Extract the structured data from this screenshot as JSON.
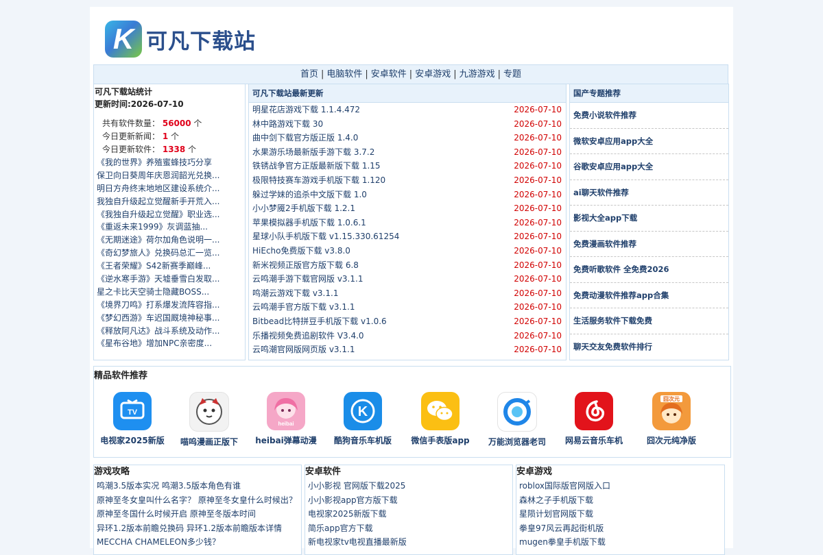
{
  "header": {
    "logo_letter": "K",
    "site_name": "可凡下载站"
  },
  "nav": {
    "items": [
      "首页",
      "电脑软件",
      "安卓软件",
      "安卓游戏",
      "九游游戏",
      "专题"
    ],
    "separator": "|"
  },
  "stats": {
    "title": "可凡下载站统计",
    "updated": "更新时间:2026-07-10",
    "software_label": "共有软件数量：",
    "software_count": "56000",
    "news_label": "今日更新新闻：",
    "news_count": "1",
    "today_soft_label": "今日更新软件：",
    "today_soft_count": "1338",
    "unit": "个",
    "news": [
      "《我的世界》养殖蜜蜂技巧分享",
      "保卫向日葵周年庆恩润韶光兑换...",
      "明日方舟终末地地区建设系统介...",
      "我独自升级起立觉醒新手开荒入...",
      "《我独自升级起立觉醒》职业选...",
      "《重返未来1999》灰调蓝抽...",
      "《无期迷途》荷尔加角色说明一...",
      "《奇幻梦旅人》兑换码总汇一览...",
      "《王者荣耀》S42新赛季巅峰...",
      "《逆水寒手游》天墟垂雪白发取...",
      "星之卡比天空骑士隐藏BOSS...",
      "《境界刀鸣》打系爆发流阵容指...",
      "《梦幻西游》车迟国厩境神秘事...",
      "《释放阿凡达》战斗系统及动作...",
      "《星布谷地》增加NPC亲密度..."
    ]
  },
  "updates": {
    "title": "可凡下载站最新更新",
    "rows": [
      {
        "name": "明星花店游戏下载 1.1.4.472",
        "date": "2026-07-10"
      },
      {
        "name": "林中路游戏下载 30",
        "date": "2026-07-10"
      },
      {
        "name": "曲中剑下载官方版正版 1.4.0",
        "date": "2026-07-10"
      },
      {
        "name": "水果游乐场最新版手游下载 3.7.2",
        "date": "2026-07-10"
      },
      {
        "name": "铁锈战争官方正版最新版下载 1.15",
        "date": "2026-07-10"
      },
      {
        "name": "极限特技赛车游戏手机版下载 1.120",
        "date": "2026-07-10"
      },
      {
        "name": "躲过学妹的追杀中文版下载 1.0",
        "date": "2026-07-10"
      },
      {
        "name": "小小梦魇2手机版下载 1.2.1",
        "date": "2026-07-10"
      },
      {
        "name": "苹果模拟器手机版下载 1.0.6.1",
        "date": "2026-07-10"
      },
      {
        "name": "星球小队手机版下载 v1.15.330.61254",
        "date": "2026-07-10"
      },
      {
        "name": "HiEcho免费版下载 v3.8.0",
        "date": "2026-07-10"
      },
      {
        "name": "新米视频正版官方版下载 6.8",
        "date": "2026-07-10"
      },
      {
        "name": "云鸣潮手游下载官网版 v3.1.1",
        "date": "2026-07-10"
      },
      {
        "name": "鸣潮云游戏下载 v3.1.1",
        "date": "2026-07-10"
      },
      {
        "name": "云鸣潮手官方版下载 v3.1.1",
        "date": "2026-07-10"
      },
      {
        "name": "Bitbead比特拼豆手机版下载 v1.0.6",
        "date": "2026-07-10"
      },
      {
        "name": "乐播视频免费追剧软件 V3.4.0",
        "date": "2026-07-10"
      },
      {
        "name": "云鸣潮官网版网页版 v3.1.1",
        "date": "2026-07-10"
      }
    ]
  },
  "topics": {
    "title": "国产专题推荐",
    "items": [
      "免费小说软件推荐",
      "微软安卓应用app大全",
      "谷歌安卓应用app大全",
      "ai聊天软件推荐",
      "影视大全app下载",
      "免费漫画软件推荐",
      "免费听歌软件 全免费2026",
      "免费动漫软件推荐app合集",
      "生活服务软件下载免费",
      "聊天交友免费软件排行"
    ]
  },
  "premium": {
    "title": "精品软件推荐",
    "apps": [
      {
        "name": "电视家2025新版",
        "icon": "tv-icon",
        "icon_text": "TV",
        "color": "#1e8ff0"
      },
      {
        "name": "喵呜漫画正版下",
        "icon": "cat-icon",
        "icon_text": "",
        "color": "#f2f2f2"
      },
      {
        "name": "heibai弹幕动漫",
        "icon": "anime-girl-icon",
        "icon_text": "heibai",
        "color": "#f5a7c7"
      },
      {
        "name": "酷狗音乐车机版",
        "icon": "kugou-icon",
        "icon_text": "K",
        "color": "#1a8de8"
      },
      {
        "name": "微信手表版app",
        "icon": "wechat-icon",
        "icon_text": "",
        "color": "#fbbf13"
      },
      {
        "name": "万能浏览器老司",
        "icon": "browser-icon",
        "icon_text": "",
        "color": "#ffffff"
      },
      {
        "name": "网易云音乐车机",
        "icon": "netease-music-icon",
        "icon_text": "",
        "color": "#e2131b"
      },
      {
        "name": "囧次元纯净版",
        "icon": "jiongciyuan-icon",
        "icon_text": "囧次元",
        "color": "#f39a3c"
      }
    ]
  },
  "bottom": {
    "guides": {
      "title": "游戏攻略",
      "items": [
        "鸣潮3.5版本实况 鸣潮3.5版本角色有谁",
        "原神至冬女皇叫什么名字？ 原神至冬女皇什么时候出？",
        "原神至冬国什么时候开启 原神至冬版本时间",
        "异环1.2版本前瞻兑换码 异环1.2版本前瞻版本详情",
        "MECCHA CHAMELEON多少钱？"
      ]
    },
    "android_soft": {
      "title": "安卓软件",
      "items": [
        "小小影视 官网版下载2025",
        "小小影视app官方版下载",
        "电视家2025新版下载",
        "简乐app官方下载",
        "新电视家tv电视直播最新版"
      ]
    },
    "android_games": {
      "title": "安卓游戏",
      "items": [
        "roblox国际版官网版入口",
        "森林之子手机版下载",
        "星陨计划官网版下载",
        "拳皇97风云再起街机版",
        "mugen拳皇手机版下载"
      ]
    }
  }
}
